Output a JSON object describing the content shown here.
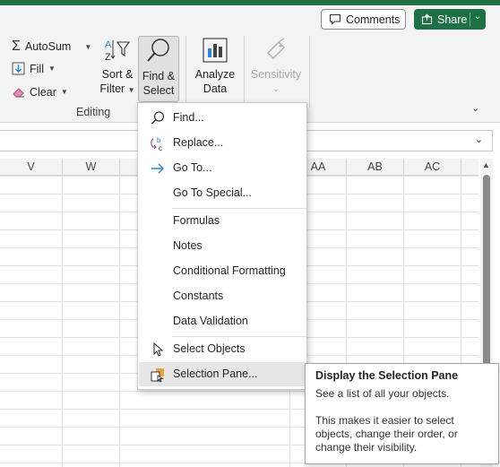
{
  "header": {
    "comments_label": "Comments",
    "share_label": "Share"
  },
  "ribbon": {
    "autosum_label": "AutoSum",
    "fill_label": "Fill",
    "clear_label": "Clear",
    "sort_filter_line1": "Sort &",
    "sort_filter_line2": "Filter",
    "find_select_line1": "Find &",
    "find_select_line2": "Select",
    "analyze_line1": "Analyze",
    "analyze_line2": "Data",
    "sensitivity_label": "Sensitivity",
    "group_label": "Editing"
  },
  "columns": [
    "V",
    "W",
    "AA",
    "AB",
    "AC"
  ],
  "menu": {
    "items": [
      {
        "label": "Find...",
        "icon": "search-icon"
      },
      {
        "label": "Replace...",
        "icon": "replace-icon"
      },
      {
        "label": "Go To...",
        "icon": "arrow-right-icon"
      },
      {
        "label": "Go To Special..."
      },
      {
        "label": "Formulas"
      },
      {
        "label": "Notes"
      },
      {
        "label": "Conditional Formatting"
      },
      {
        "label": "Constants"
      },
      {
        "label": "Data Validation"
      },
      {
        "label": "Select Objects",
        "icon": "pointer-icon"
      },
      {
        "label": "Selection Pane...",
        "icon": "selection-pane-icon"
      }
    ]
  },
  "tooltip": {
    "title": "Display the Selection Pane",
    "line1": "See a list of all your objects.",
    "line2": "This makes it easier to select",
    "line3": "objects, change their order, or",
    "line4": "change their visibility."
  },
  "colors": {
    "brand_green": "#217346",
    "share_green": "#1e7145",
    "go_to_blue": "#2b88d8",
    "pane_orange": "#e8a33c"
  }
}
